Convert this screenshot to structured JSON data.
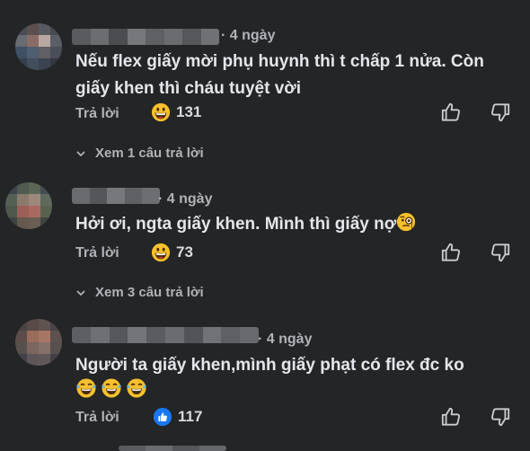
{
  "comments": [
    {
      "time": "· 4 ngày",
      "text_lines": [
        "Nếu flex giấy mời phụ huynh thì t chấp 1 nửa. Còn",
        "giấy khen thì cháu tuyệt vời"
      ],
      "reply_label": "Trả lời",
      "reaction_icon": "grinning-face",
      "reaction_count": "131",
      "view_replies": "Xem 1 câu trả lời"
    },
    {
      "time": "· 4 ngày",
      "text": "Hởi ơi, ngta giấy khen. Mình thì giấy nợ",
      "trailing_emoji": "face-with-monocle",
      "reply_label": "Trả lời",
      "reaction_icon": "grinning-face",
      "reaction_count": "73",
      "view_replies": "Xem 3 câu trả lời"
    },
    {
      "time": "· 4 ngày",
      "text": "Người ta giấy khen,mình giấy phạt có flex đc ko",
      "emoji_line": [
        "tears-of-joy",
        "tears-of-joy",
        "tears-of-joy"
      ],
      "reply_label": "Trả lời",
      "reaction_icon": "like-thumb",
      "reaction_count": "117"
    }
  ],
  "icons": {
    "like": "thumbs-up-outline-icon",
    "dislike": "thumbs-down-outline-icon",
    "chevron": "chevron-down-icon"
  },
  "colors": {
    "background": "#242526",
    "primary_text": "#e4e6eb",
    "secondary_text": "#b0b3b8",
    "like_blue": "#1877f2"
  }
}
